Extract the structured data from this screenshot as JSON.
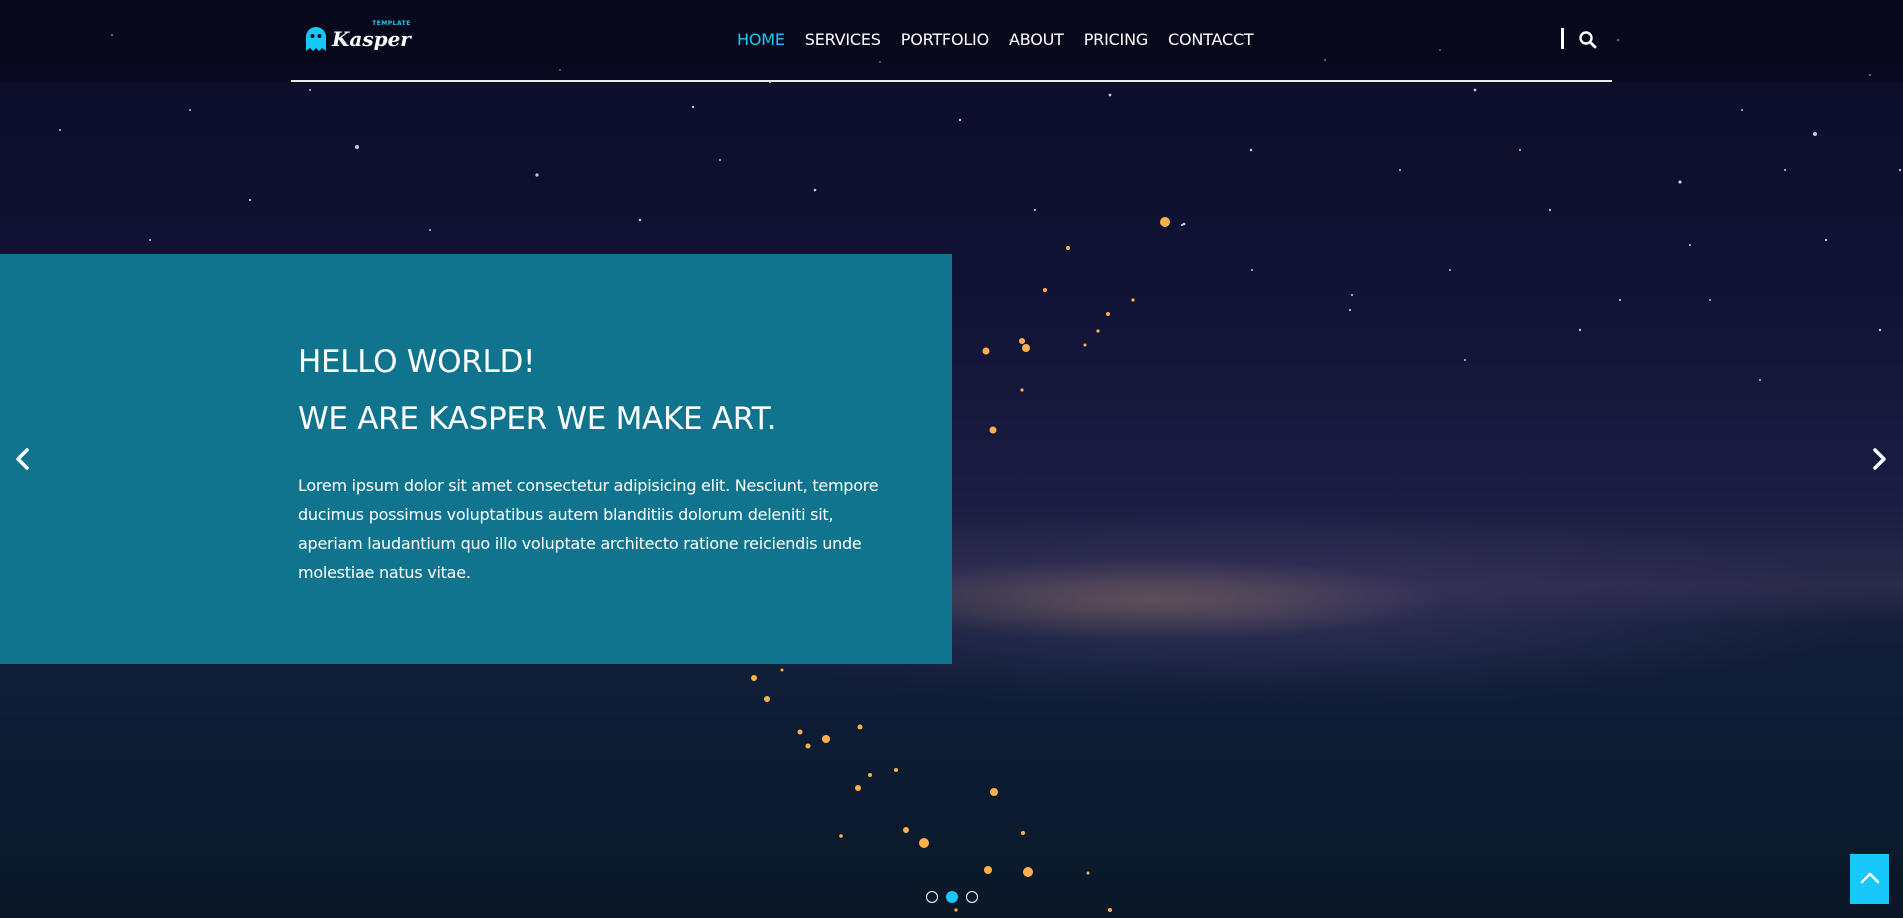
{
  "brand": {
    "name": "Kasper",
    "tagline": "TEMPLATE",
    "accent_color": "#19c8fa"
  },
  "nav": {
    "items": [
      {
        "label": "HOME",
        "active": true
      },
      {
        "label": "SERVICES",
        "active": false
      },
      {
        "label": "PORTFOLIO",
        "active": false
      },
      {
        "label": "ABOUT",
        "active": false
      },
      {
        "label": "PRICING",
        "active": false
      },
      {
        "label": "CONTACCT",
        "active": false
      }
    ],
    "search_icon": "search-icon"
  },
  "hero": {
    "heading_line1": "HELLO WORLD!",
    "heading_line2": "WE ARE KASPER WE MAKE ART.",
    "paragraph": "Lorem ipsum dolor sit amet consectetur adipisicing elit. Nesciunt, tempore ducimus possimus voluptatibus autem blanditiis dolorum deleniti sit, aperiam laudantium quo illo voluptate architecto ratione reiciendis unde molestiae natus vitae.",
    "box_color": "#10748f"
  },
  "carousel": {
    "prev_icon": "chevron-left-icon",
    "next_icon": "chevron-right-icon",
    "slides_count": 3,
    "active_index": 1
  },
  "scroll_top": {
    "icon": "chevron-up-icon",
    "color": "#19c8fa"
  }
}
